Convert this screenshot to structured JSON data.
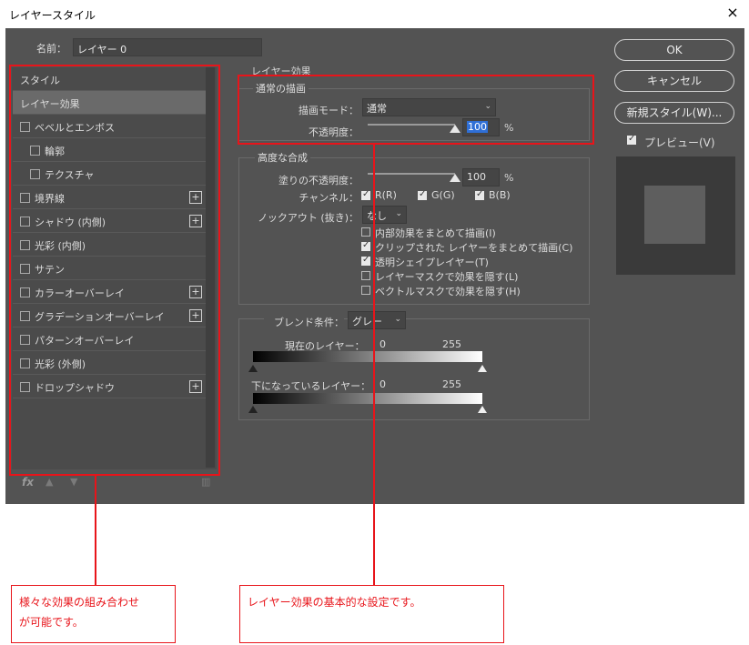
{
  "window": {
    "title": "レイヤースタイル",
    "close_glyph": "×"
  },
  "name_row": {
    "label": "名前：",
    "value": "レイヤー 0"
  },
  "left_list": {
    "items": [
      {
        "label": "スタイル",
        "checkbox": false,
        "plus": false,
        "indent": false,
        "selected": false
      },
      {
        "label": "レイヤー効果",
        "checkbox": false,
        "plus": false,
        "indent": false,
        "selected": true
      },
      {
        "label": "ベベルとエンボス",
        "checkbox": true,
        "plus": false,
        "indent": false,
        "selected": false
      },
      {
        "label": "輪郭",
        "checkbox": true,
        "plus": false,
        "indent": true,
        "selected": false
      },
      {
        "label": "テクスチャ",
        "checkbox": true,
        "plus": false,
        "indent": true,
        "selected": false
      },
      {
        "label": "境界線",
        "checkbox": true,
        "plus": true,
        "indent": false,
        "selected": false
      },
      {
        "label": "シャドウ (内側)",
        "checkbox": true,
        "plus": true,
        "indent": false,
        "selected": false
      },
      {
        "label": "光彩 (内側)",
        "checkbox": true,
        "plus": false,
        "indent": false,
        "selected": false
      },
      {
        "label": "サテン",
        "checkbox": true,
        "plus": false,
        "indent": false,
        "selected": false
      },
      {
        "label": "カラーオーバーレイ",
        "checkbox": true,
        "plus": true,
        "indent": false,
        "selected": false
      },
      {
        "label": "グラデーションオーバーレイ",
        "checkbox": true,
        "plus": true,
        "indent": false,
        "selected": false
      },
      {
        "label": "パターンオーバーレイ",
        "checkbox": true,
        "plus": false,
        "indent": false,
        "selected": false
      },
      {
        "label": "光彩 (外側)",
        "checkbox": true,
        "plus": false,
        "indent": false,
        "selected": false
      },
      {
        "label": "ドロップシャドウ",
        "checkbox": true,
        "plus": true,
        "indent": false,
        "selected": false
      }
    ],
    "plus_glyph": "+",
    "footer": {
      "fx": "fx",
      "up": "▲",
      "down": "▼",
      "trash": "🗑"
    }
  },
  "effects": {
    "title": "レイヤー効果",
    "normal": {
      "title": "通常の描画",
      "blend_mode_label": "描画モード：",
      "blend_mode_value": "通常",
      "opacity_label": "不透明度：",
      "opacity_value": "100",
      "opacity_percent": 1.0,
      "unit": "%"
    },
    "advanced": {
      "title": "高度な合成",
      "fill_opacity_label": "塗りの不透明度：",
      "fill_opacity_value": "100",
      "fill_opacity_percent": 1.0,
      "unit": "%",
      "channels_label": "チャンネル：",
      "channels": [
        {
          "label": "R(R)",
          "checked": true
        },
        {
          "label": "G(G)",
          "checked": true
        },
        {
          "label": "B(B)",
          "checked": true
        }
      ],
      "knockout_label": "ノックアウト (抜き)：",
      "knockout_value": "なし",
      "options": [
        {
          "label": "内部効果をまとめて描画(I)",
          "checked": false
        },
        {
          "label": "クリップされた レイヤーをまとめて描画(C)",
          "checked": true
        },
        {
          "label": "透明シェイプレイヤー(T)",
          "checked": true
        },
        {
          "label": "レイヤーマスクで効果を隠す(L)",
          "checked": false
        },
        {
          "label": "ベクトルマスクで効果を隠す(H)",
          "checked": false
        }
      ]
    },
    "blend_if": {
      "label": "ブレンド条件：",
      "value": "グレー",
      "current_layer_label": "現在のレイヤー：",
      "underlying_layer_label": "下になっているレイヤー：",
      "low": "0",
      "high": "255"
    }
  },
  "right": {
    "ok": "OK",
    "cancel": "キャンセル",
    "new_style": "新規スタイル(W)...",
    "preview_label": "プレビュー(V)",
    "preview_checked": true
  },
  "annotations": {
    "left_note": "様々な効果の組み合わせが可能です。",
    "left_note_line1": "様々な効果の組み合わせ",
    "left_note_line2": "が可能です。",
    "right_note": "レイヤー効果の基本的な設定です。",
    "color": "#e8141a"
  },
  "colors": {
    "dialog_bg": "#535353",
    "panel_bg": "#4b4b4b",
    "selected_bg": "#6a6a6a",
    "accent_blue": "#2f6fd6"
  }
}
